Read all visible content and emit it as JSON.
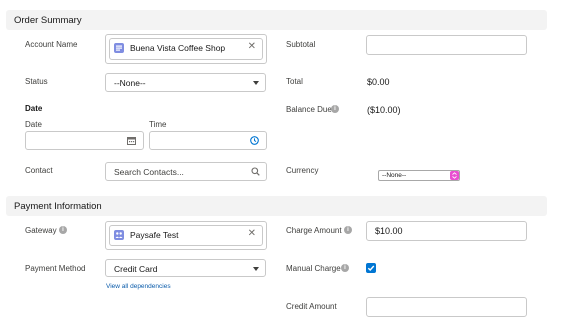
{
  "order_summary": {
    "title": "Order Summary",
    "account_name": {
      "label": "Account Name",
      "value": "Buena Vista Coffee Shop",
      "icon": "account-icon"
    },
    "status": {
      "label": "Status",
      "value": "--None--"
    },
    "date_group": {
      "title": "Date",
      "date_label": "Date",
      "time_label": "Time"
    },
    "contact": {
      "label": "Contact",
      "placeholder": "Search Contacts..."
    },
    "subtotal": {
      "label": "Subtotal",
      "value": ""
    },
    "total": {
      "label": "Total",
      "value": "$0.00"
    },
    "balance_due": {
      "label": "Balance Due",
      "value": "($10.00)"
    },
    "currency": {
      "label": "Currency",
      "value": "--None--"
    }
  },
  "payment_information": {
    "title": "Payment Information",
    "gateway": {
      "label": "Gateway",
      "value": "Paysafe Test",
      "icon": "gateway-icon"
    },
    "payment_method": {
      "label": "Payment Method",
      "value": "Credit Card",
      "link": "View all dependencies"
    },
    "charge_amount": {
      "label": "Charge Amount",
      "value": "$10.00"
    },
    "manual_charge": {
      "label": "Manual Charge",
      "checked": true
    },
    "credit_amount": {
      "label": "Credit Amount",
      "value": ""
    }
  },
  "colors": {
    "accent": "#0176d3",
    "pill_icon": "#7f8de1",
    "currency_toggle": "#e94fd1"
  }
}
